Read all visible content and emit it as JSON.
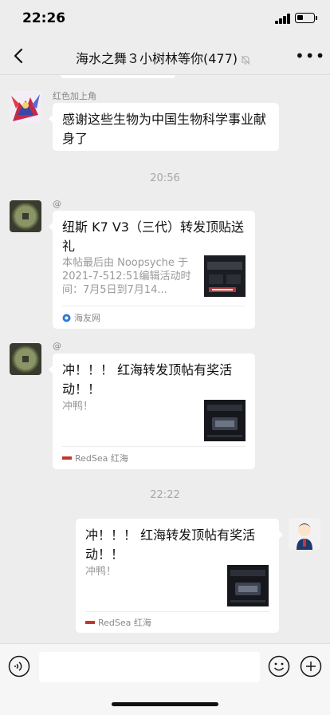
{
  "status_bar": {
    "time": "22:26",
    "battery_level": 0.35
  },
  "nav": {
    "title": "海水之舞３小树林等你(477)",
    "back_icon": "chevron-left-icon",
    "mute_icon": "mute-bell-icon",
    "more_icon": "ellipsis-icon"
  },
  "messages": [
    {
      "type": "text",
      "side": "left",
      "sender": "红色加上角",
      "text": "感谢这些生物为中国生物科学事业献身了"
    },
    {
      "type": "time",
      "text": "20:56"
    },
    {
      "type": "link-card",
      "side": "left",
      "sender": "@",
      "title": "纽斯 K7 V3（三代）转发顶贴送礼",
      "desc": "本帖最后由 Noopsyche 于 2021-7-512:51编辑活动时间：7月5日到7月14...",
      "source": "海友网"
    },
    {
      "type": "link-card",
      "side": "left",
      "sender": "@",
      "title": "冲！！！ 红海转发顶帖有奖活动！！",
      "desc": "冲鸭！",
      "source": "RedSea 红海"
    },
    {
      "type": "time",
      "text": "22:22"
    },
    {
      "type": "link-card",
      "side": "right",
      "title": "冲！！！ 红海转发顶帖有奖活动！！",
      "desc": "冲鸭！",
      "source": "RedSea 红海"
    }
  ],
  "input_bar": {
    "placeholder": "",
    "voice_icon": "voice-icon",
    "emoji_icon": "emoji-icon",
    "plus_icon": "plus-icon"
  }
}
